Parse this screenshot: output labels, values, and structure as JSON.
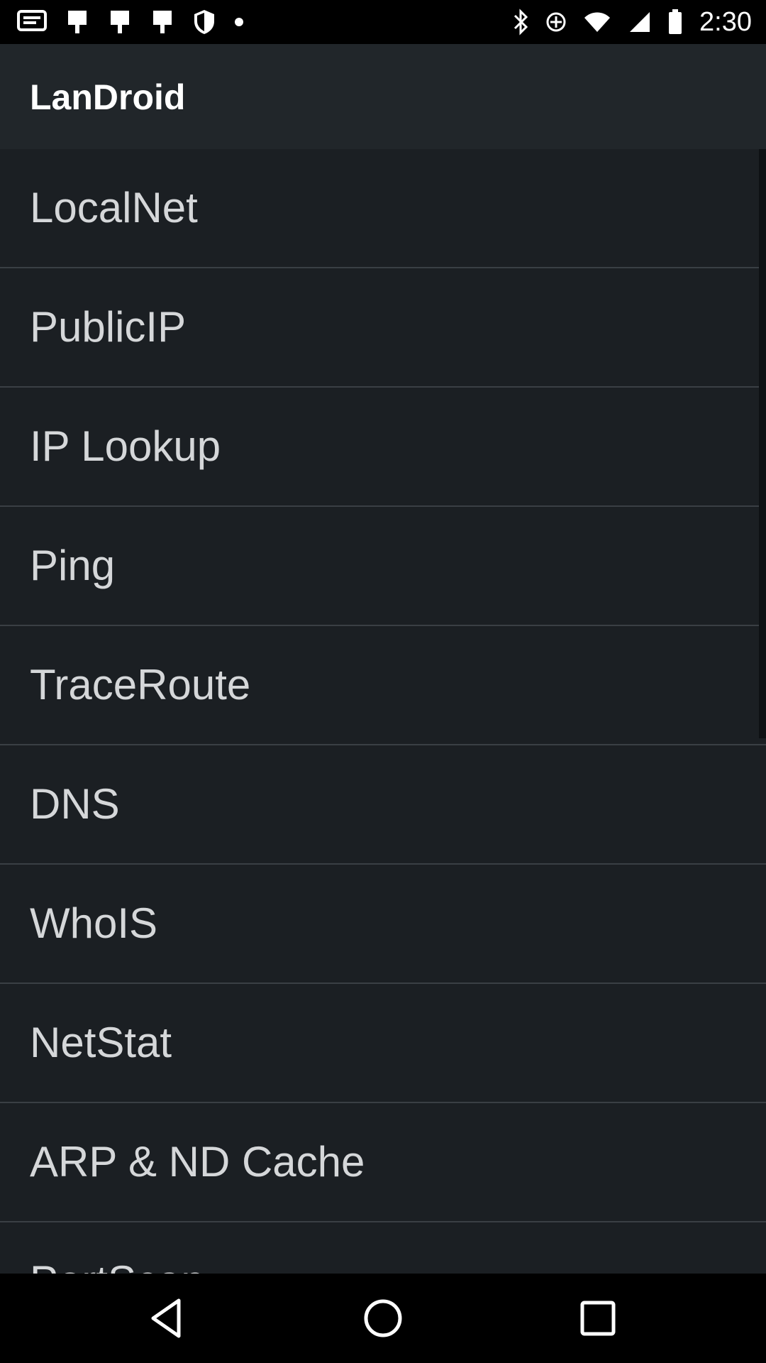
{
  "status_bar": {
    "time": "2:30",
    "left_icons": [
      "message-icon",
      "notification-icon",
      "notification-icon",
      "notification-icon",
      "vpn-shield-icon",
      "dot-icon"
    ],
    "right_icons": [
      "bluetooth-icon",
      "battery-saver-icon",
      "wifi-icon",
      "signal-icon",
      "battery-icon"
    ]
  },
  "app_bar": {
    "title": "LanDroid"
  },
  "menu": {
    "items": [
      {
        "label": "LocalNet"
      },
      {
        "label": "PublicIP"
      },
      {
        "label": "IP Lookup"
      },
      {
        "label": "Ping"
      },
      {
        "label": "TraceRoute"
      },
      {
        "label": "DNS"
      },
      {
        "label": "WhoIS"
      },
      {
        "label": "NetStat"
      },
      {
        "label": "ARP & ND Cache"
      },
      {
        "label": "PortScan"
      }
    ]
  },
  "nav_bar": {
    "buttons": [
      "back-icon",
      "home-icon",
      "recents-icon"
    ]
  },
  "colors": {
    "app_bar_bg": "#21262a",
    "list_bg": "#1b1f23",
    "divider": "#3a3f44",
    "text": "#d5d7d9"
  }
}
